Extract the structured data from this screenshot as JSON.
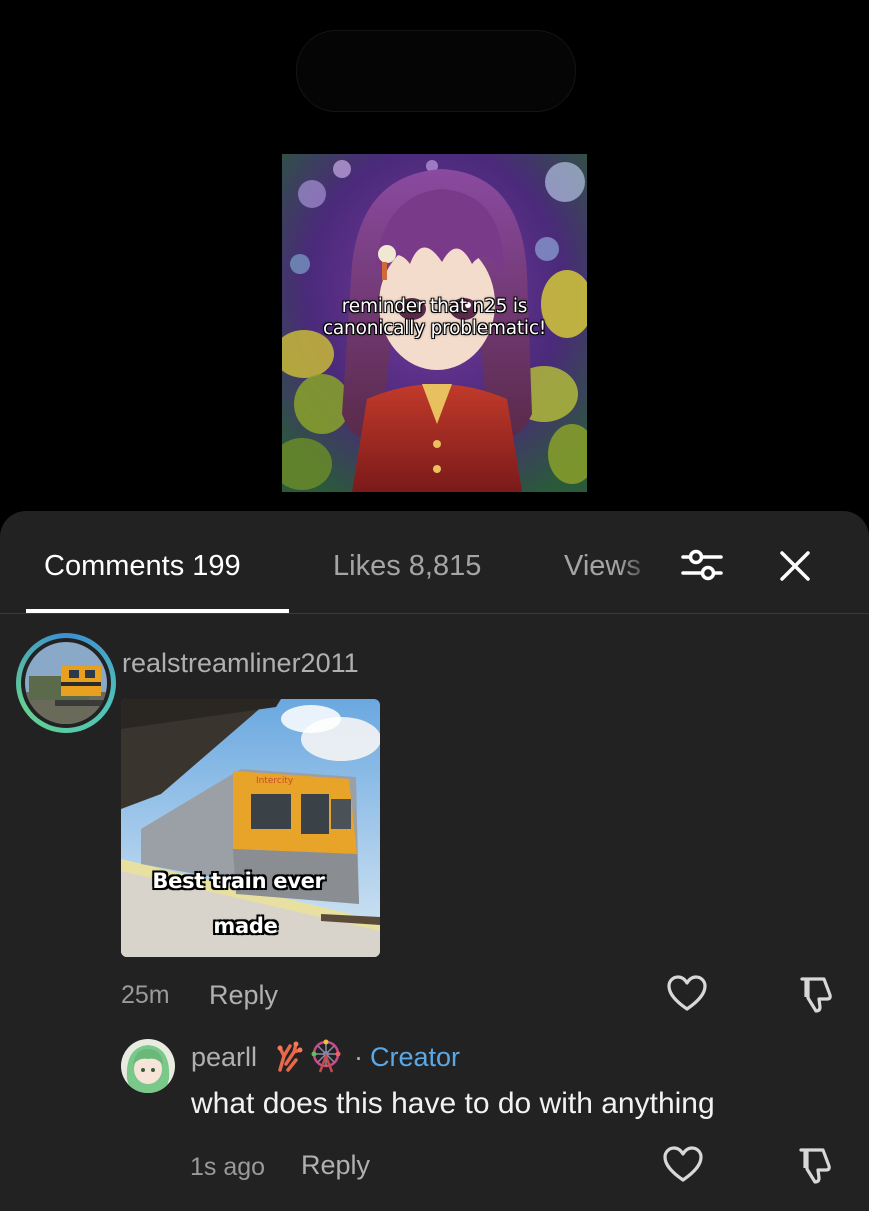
{
  "video": {
    "caption_line1": "reminder that n25 is",
    "caption_line2": "canonically problematic!"
  },
  "tabs": {
    "comments_label": "Comments 199",
    "likes_label": "Likes 8,815",
    "views_label": "Views"
  },
  "toolbar": {
    "filter_icon": "sliders-icon",
    "close_icon": "close-icon"
  },
  "comment": {
    "username": "realstreamliner2011",
    "image_caption_line1": "Best train ever",
    "image_caption_line2": "made",
    "image_train_brand": "Intercity",
    "time": "25m",
    "reply_label": "Reply"
  },
  "reply": {
    "username": "pearll",
    "badges": [
      "coral-emoji",
      "ferris-wheel-emoji"
    ],
    "separator": "·",
    "creator_label": "Creator",
    "text": "what does this have to do with anything",
    "time": "1s ago",
    "reply_label": "Reply"
  },
  "colors": {
    "background": "#000000",
    "sheet": "#222222",
    "creator": "#5aa9e6",
    "muted_text": "#b0b0b0"
  }
}
